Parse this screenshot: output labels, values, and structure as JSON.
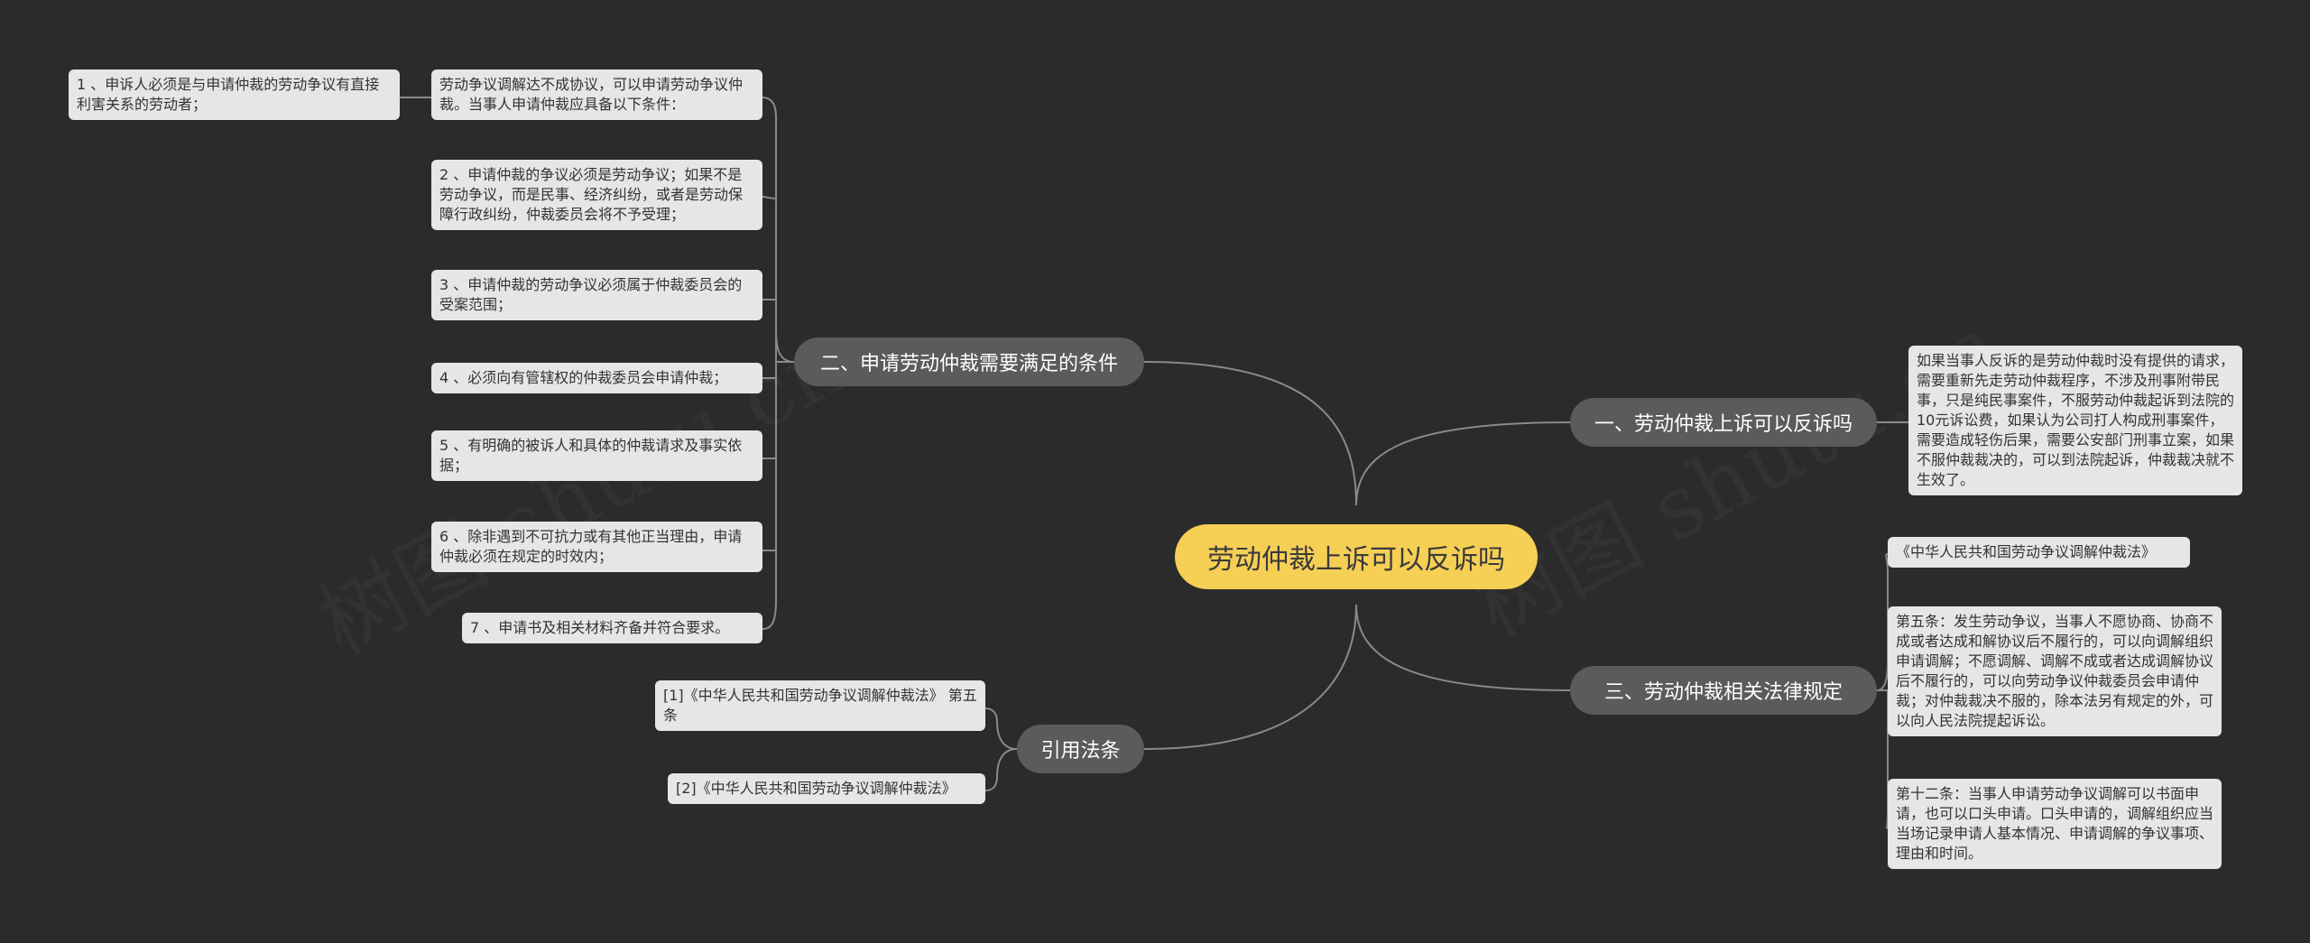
{
  "root": {
    "title": "劳动仲裁上诉可以反诉吗"
  },
  "branches": {
    "b1": {
      "title": "一、劳动仲裁上诉可以反诉吗",
      "leaf": "如果当事人反诉的是劳动仲裁时没有提供的请求，需要重新先走劳动仲裁程序，不涉及刑事附带民事，只是纯民事案件，不服劳动仲裁起诉到法院的10元诉讼费，如果认为公司打人构成刑事案件，需要造成轻伤后果，需要公安部门刑事立案，如果不服仲裁裁决的，可以到法院起诉，仲裁裁决就不生效了。"
    },
    "b2": {
      "title": "二、申请劳动仲裁需要满足的条件",
      "intro": "劳动争议调解达不成协议，可以申请劳动争议仲裁。当事人申请仲裁应具备以下条件：",
      "sub": "1 、申诉人必须是与申请仲裁的劳动争议有直接利害关系的劳动者；",
      "items": [
        "2 、申请仲裁的争议必须是劳动争议；如果不是劳动争议，而是民事、经济纠纷，或者是劳动保障行政纠纷，仲裁委员会将不予受理；",
        "3 、申请仲裁的劳动争议必须属于仲裁委员会的受案范围；",
        "4 、必须向有管辖权的仲裁委员会申请仲裁；",
        "5 、有明确的被诉人和具体的仲裁请求及事实依据；",
        "6 、除非遇到不可抗力或有其他正当理由，申请仲裁必须在规定的时效内；",
        "7 、申请书及相关材料齐备并符合要求。"
      ]
    },
    "b3": {
      "title": "三、劳动仲裁相关法律规定",
      "items": [
        "《中华人民共和国劳动争议调解仲裁法》",
        "第五条：发生劳动争议，当事人不愿协商、协商不成或者达成和解协议后不履行的，可以向调解组织申请调解；不愿调解、调解不成或者达成调解协议后不履行的，可以向劳动争议仲裁委员会申请仲裁；对仲裁裁决不服的，除本法另有规定的外，可以向人民法院提起诉讼。",
        "第十二条：当事人申请劳动争议调解可以书面申请，也可以口头申请。口头申请的，调解组织应当当场记录申请人基本情况、申请调解的争议事项、理由和时间。"
      ]
    },
    "b4": {
      "title": "引用法条",
      "items": [
        "[1]《中华人民共和国劳动争议调解仲裁法》 第五条",
        "[2]《中华人民共和国劳动争议调解仲裁法》"
      ]
    }
  },
  "watermark": "树图 shutu.cn",
  "colors": {
    "background": "#2b2b2b",
    "root": "#f6cf55",
    "branch": "#5d5b59",
    "leaf": "#e6e6e6",
    "line": "#8a8a8a"
  }
}
